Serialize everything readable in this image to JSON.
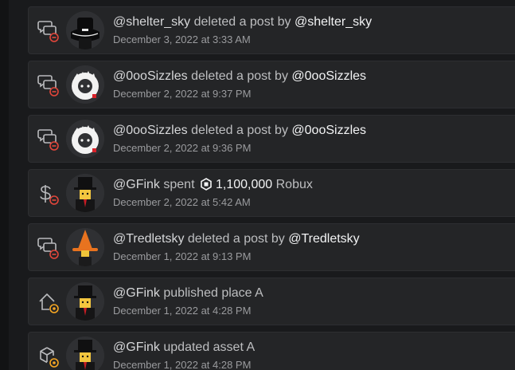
{
  "entries": [
    {
      "type": "delete",
      "actor": "@shelter_sky",
      "action": "deleted a post by",
      "target": "@shelter_sky",
      "timestamp": "December 3, 2022 at 3:33 AM",
      "activity_icon": "chat-delete-icon",
      "avatar": "dark-avatar"
    },
    {
      "type": "delete",
      "actor": "@0ooSizzles",
      "action": "deleted a post by",
      "target": "@0ooSizzles",
      "timestamp": "December 2, 2022 at 9:37 PM",
      "activity_icon": "chat-delete-icon",
      "avatar": "white-blob-avatar"
    },
    {
      "type": "delete",
      "actor": "@0ooSizzles",
      "action": "deleted a post by",
      "target": "@0ooSizzles",
      "timestamp": "December 2, 2022 at 9:36 PM",
      "activity_icon": "chat-delete-icon",
      "avatar": "white-blob-avatar"
    },
    {
      "type": "spend",
      "actor": "@GFink",
      "action": "spent",
      "amount": "1,100,000",
      "currency": "Robux",
      "timestamp": "December 2, 2022 at 5:42 AM",
      "activity_icon": "dollar-remove-icon",
      "avatar": "tophat-avatar"
    },
    {
      "type": "delete",
      "actor": "@Tredletsky",
      "action": "deleted a post by",
      "target": "@Tredletsky",
      "timestamp": "December 1, 2022 at 9:13 PM",
      "activity_icon": "chat-delete-icon",
      "avatar": "orange-witch-avatar"
    },
    {
      "type": "text",
      "actor": "@GFink",
      "action": "published place A",
      "timestamp": "December 1, 2022 at 4:28 PM",
      "activity_icon": "home-publish-icon",
      "avatar": "tophat-avatar"
    },
    {
      "type": "text",
      "actor": "@GFink",
      "action": "updated asset A",
      "timestamp": "December 1, 2022 at 4:28 PM",
      "activity_icon": "box-update-icon",
      "avatar": "tophat-avatar"
    }
  ],
  "colors": {
    "remove_badge": "#e2463b",
    "update_badge": "#f5a623",
    "icon_stroke": "#b9babd"
  }
}
